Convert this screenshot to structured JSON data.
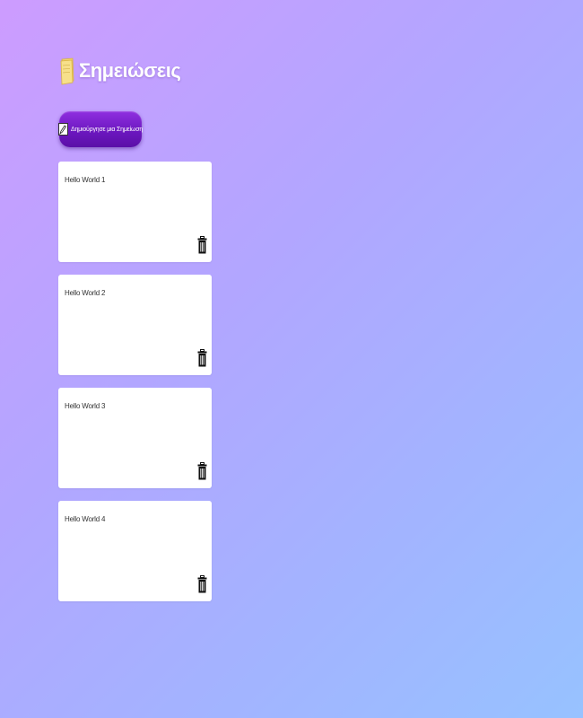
{
  "header": {
    "icon": "sticky-note-icon",
    "title": "Σημειώσεις"
  },
  "toolbar": {
    "create_icon": "pencil-icon",
    "create_label": "Δημιούργησε μια Σημείωση"
  },
  "notes": [
    {
      "text": "Hello World 1",
      "delete_icon": "trash-icon"
    },
    {
      "text": "Hello World 2",
      "delete_icon": "trash-icon"
    },
    {
      "text": "Hello World 3",
      "delete_icon": "trash-icon"
    },
    {
      "text": "Hello World 4",
      "delete_icon": "trash-icon"
    }
  ],
  "colors": {
    "button_top": "#8f2fe0",
    "button_bottom": "#5b0fa8",
    "bg_start": "#cd9cff",
    "bg_end": "#97c2ff"
  }
}
